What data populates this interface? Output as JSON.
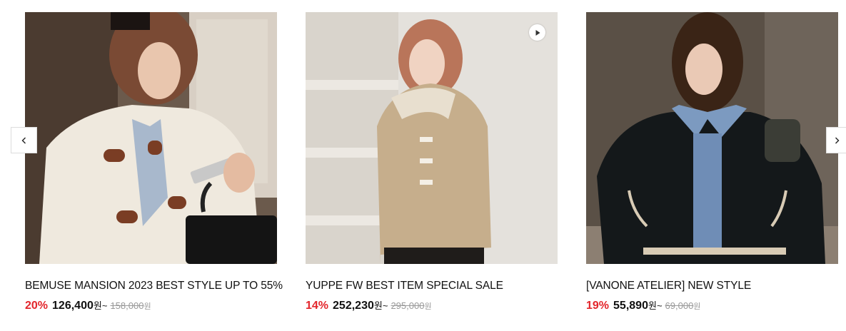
{
  "carousel": {
    "prev_icon": "chevron-left-icon",
    "next_icon": "chevron-right-icon",
    "products": [
      {
        "title": "BEMUSE MANSION 2023 BEST STYLE UP TO 55%",
        "discount": "20%",
        "price": "126,400",
        "won": "원",
        "tilde": "~",
        "original_price": "158,000",
        "original_won": "원",
        "has_video": false
      },
      {
        "title": "YUPPE FW BEST ITEM SPECIAL SALE",
        "discount": "14%",
        "price": "252,230",
        "won": "원",
        "tilde": "~",
        "original_price": "295,000",
        "original_won": "원",
        "has_video": true,
        "video_icon": "play-icon"
      },
      {
        "title": "[VANONE ATELIER] NEW STYLE",
        "discount": "19%",
        "price": "55,890",
        "won": "원",
        "tilde": "~",
        "original_price": "69,000",
        "original_won": "원",
        "has_video": false
      }
    ]
  },
  "colors": {
    "discount": "#e3262c",
    "strike_price": "#999999",
    "text": "#111111"
  }
}
